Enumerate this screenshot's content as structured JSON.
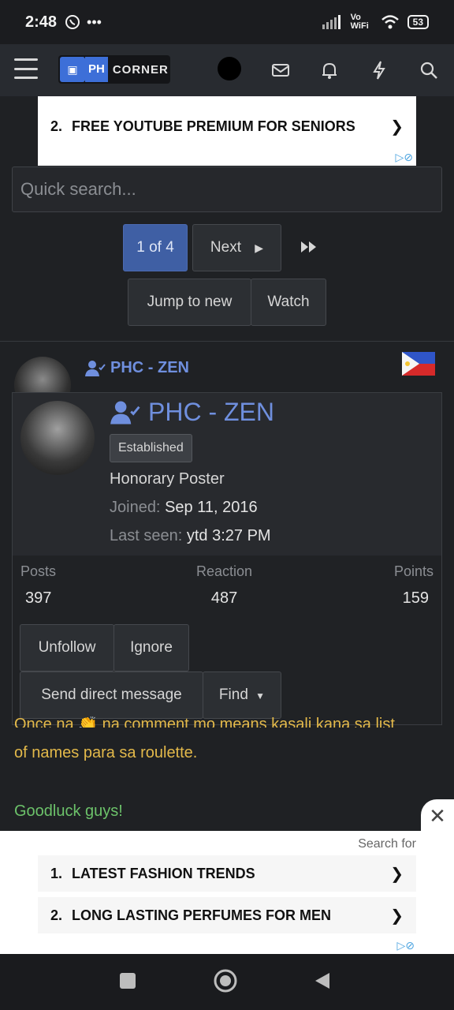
{
  "status_bar": {
    "time": "2:48",
    "extra": "•••",
    "network": "Vo WiFi",
    "battery": "53"
  },
  "navbar": {
    "logo_ph": "PH",
    "logo_corner": "CORNER",
    "icons": [
      "menu-icon",
      "envelope-icon",
      "bell-icon",
      "bolt-icon",
      "search-icon"
    ]
  },
  "ad_top": {
    "items": [
      {
        "num": "2.",
        "text": "FREE YOUTUBE PREMIUM FOR SENIORS",
        "chev": "❯"
      }
    ]
  },
  "search": {
    "placeholder": "Quick search..."
  },
  "pagination": {
    "current": "1 of 4",
    "next": "Next",
    "jump": "Jump to new",
    "watch": "Watch"
  },
  "post": {
    "username": "PHC - ZEN"
  },
  "popup": {
    "username": "PHC - ZEN",
    "badge": "Established",
    "user_title": "Honorary Poster",
    "joined_label": "Joined:",
    "joined_value": "Sep 11, 2016",
    "last_seen_label": "Last seen:",
    "last_seen_value": "ytd 3:27 PM",
    "stats": [
      {
        "label": "Posts",
        "value": "397"
      },
      {
        "label": "Reaction",
        "value": "487"
      },
      {
        "label": "Points",
        "value": "159"
      }
    ],
    "buttons": {
      "unfollow": "Unfollow",
      "ignore": "Ignore",
      "message": "Send direct message",
      "find": "Find"
    }
  },
  "post_body": {
    "line_partial": "Once na 👏 na comment mo means kasali kana sa list",
    "line2": "of names para sa roulette.",
    "line3": "Goodluck guys!"
  },
  "ad_bottom": {
    "search_for": "Search for",
    "items": [
      {
        "num": "1.",
        "text": "LATEST FASHION TRENDS",
        "chev": "❯"
      },
      {
        "num": "2.",
        "text": "LONG LASTING PERFUMES FOR MEN",
        "chev": "❯"
      }
    ]
  },
  "colors": {
    "accent": "#6f8fde",
    "primary_btn": "#3f5fa4",
    "post_yellow": "#e3b94a",
    "post_green": "#6cc26a"
  }
}
